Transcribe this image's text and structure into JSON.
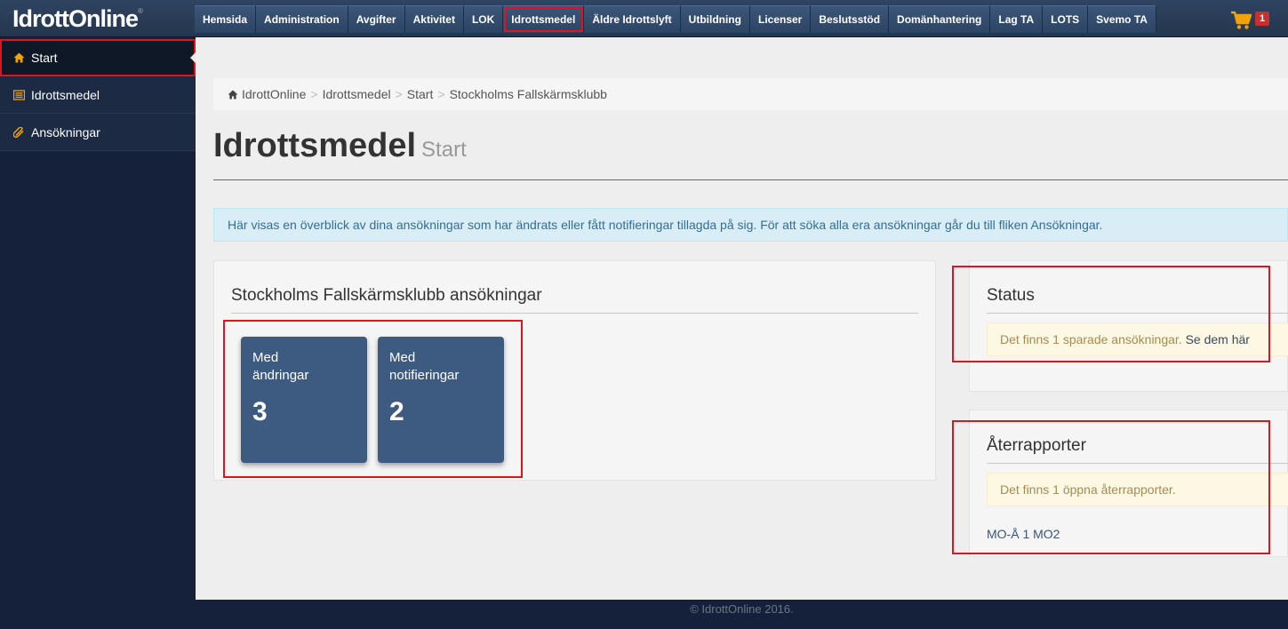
{
  "brand": {
    "name": "IdrottOnline",
    "mark": "®"
  },
  "nav": {
    "items": [
      "Hemsida",
      "Administration",
      "Avgifter",
      "Aktivitet",
      "LOK",
      "Idrottsmedel",
      "Äldre Idrottslyft",
      "Utbildning",
      "Licenser",
      "Beslutsstöd",
      "Domänhantering",
      "Lag TA",
      "LOTS",
      "Svemo TA"
    ],
    "highlighted": "Idrottsmedel"
  },
  "cart": {
    "count": "1"
  },
  "sidebar": {
    "items": [
      {
        "label": "Start",
        "icon": "home-icon"
      },
      {
        "label": "Idrottsmedel",
        "icon": "list-icon"
      },
      {
        "label": "Ansökningar",
        "icon": "paperclip-icon"
      }
    ]
  },
  "breadcrumb": {
    "items": [
      "IdrottOnline",
      "Idrottsmedel",
      "Start",
      "Stockholms Fallskärmsklubb"
    ],
    "sep": ">"
  },
  "page": {
    "title": "Idrottsmedel",
    "subtitle": "Start"
  },
  "info": {
    "text": "Här visas en överblick av dina ansökningar som har ändrats eller fått notifieringar tillagda på sig. För att söka alla era ansökningar går du till fliken Ansökningar."
  },
  "applications": {
    "title": "Stockholms Fallskärmsklubb ansökningar",
    "tiles": [
      {
        "label": "Med ändringar",
        "value": "3"
      },
      {
        "label": "Med notifieringar",
        "value": "2"
      }
    ]
  },
  "status": {
    "title": "Status",
    "message": "Det finns 1 sparade ansökningar.",
    "link": "Se dem här"
  },
  "reports": {
    "title": "Återrapporter",
    "message": "Det finns 1 öppna återrapporter.",
    "link": "MO-Å 1 MO2"
  },
  "footer": {
    "text": "© IdrottOnline 2016."
  },
  "colors": {
    "highlight": "#e0141c",
    "tile": "#3d5a80",
    "topbar": "#2f4461"
  }
}
